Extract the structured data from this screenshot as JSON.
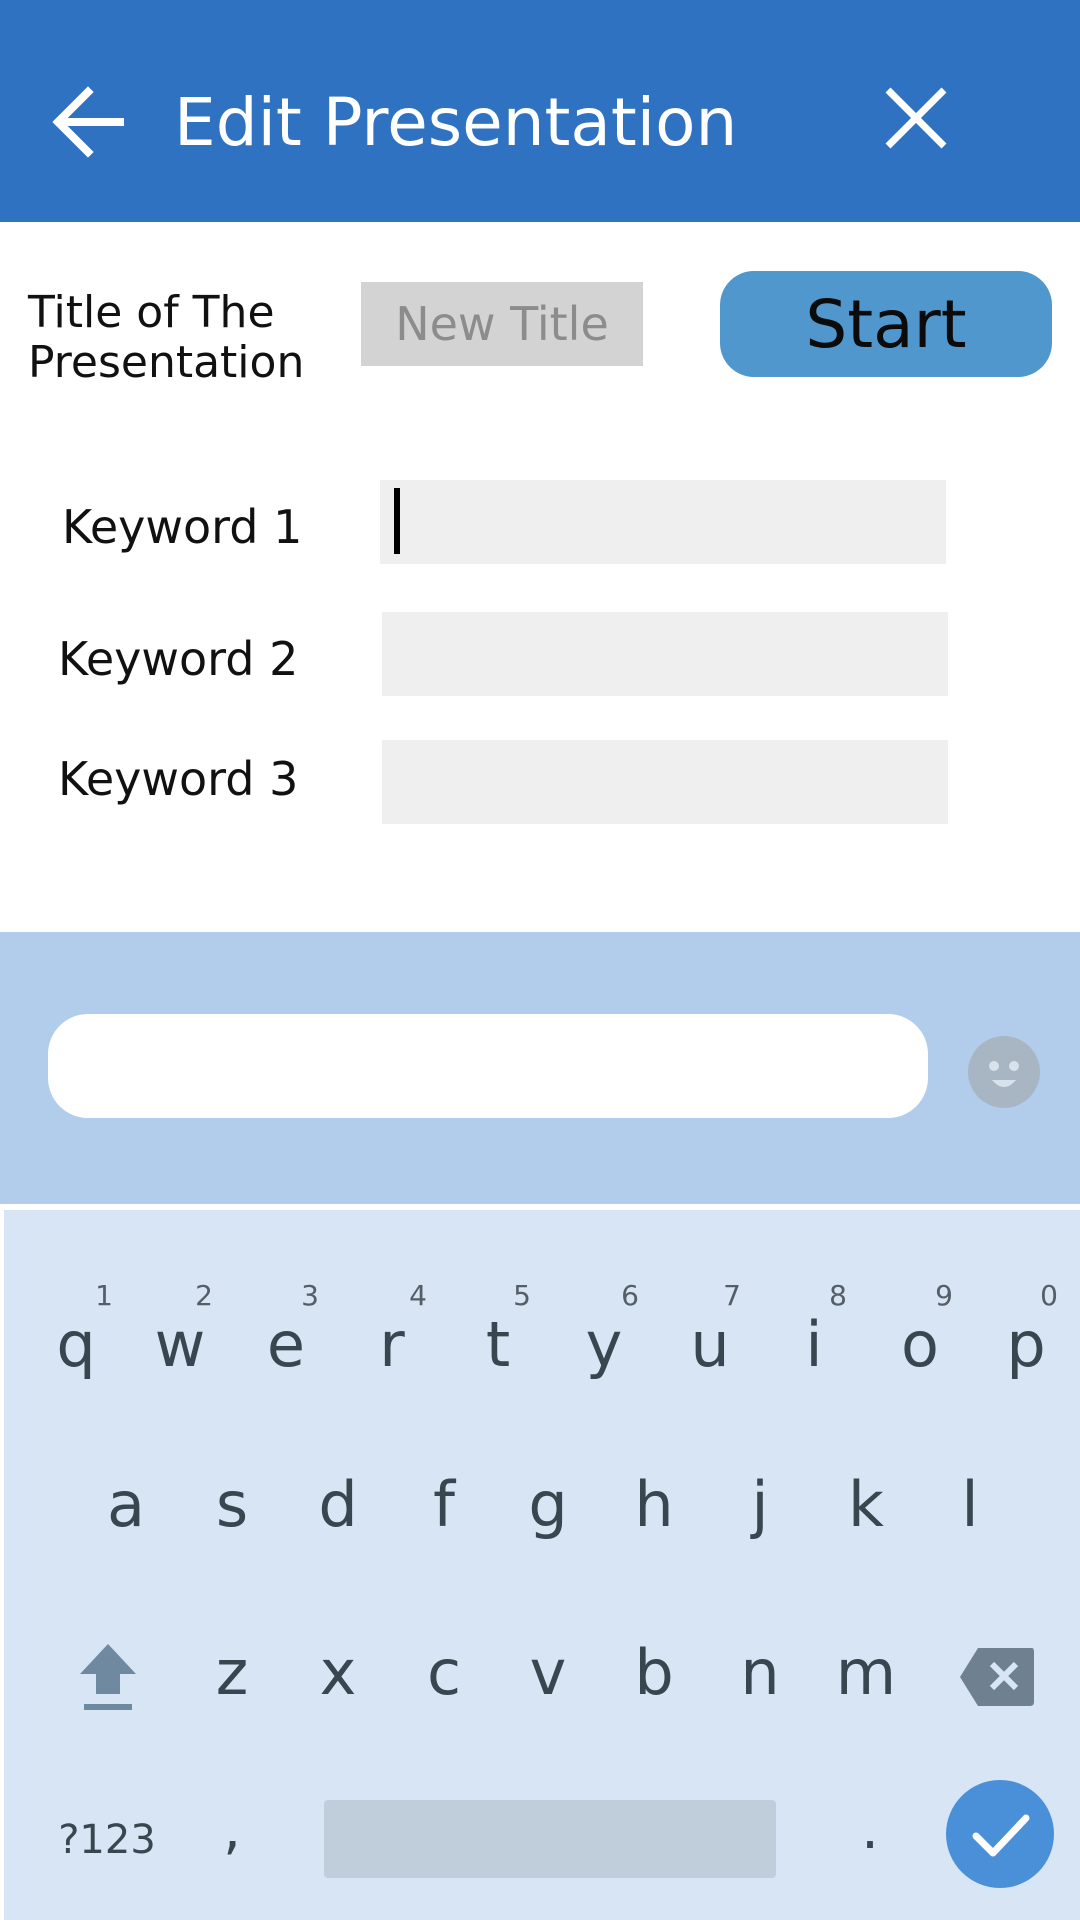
{
  "header": {
    "title": "Edit Presentation",
    "background_color": "#2f72c2",
    "back_icon": "arrow-left",
    "close_icon": "close-x"
  },
  "form": {
    "title_label": "Title of The Presentation",
    "title_placeholder": "New Title",
    "start_label": "Start",
    "start_color": "#4f97cc",
    "keywords": [
      {
        "label": "Keyword 1",
        "value": ""
      },
      {
        "label": "Keyword 2",
        "value": ""
      },
      {
        "label": "Keyword 3",
        "value": ""
      }
    ]
  },
  "keyboard": {
    "background_color": "#d8e5f5",
    "suggestion_bar_color": "#b2cdeb",
    "row1": [
      "q",
      "w",
      "e",
      "r",
      "t",
      "y",
      "u",
      "i",
      "o",
      "p"
    ],
    "row1_hints": [
      "1",
      "2",
      "3",
      "4",
      "5",
      "6",
      "7",
      "8",
      "9",
      "0"
    ],
    "row2": [
      "a",
      "s",
      "d",
      "f",
      "g",
      "h",
      "j",
      "k",
      "l"
    ],
    "row3": [
      "z",
      "x",
      "c",
      "v",
      "b",
      "n",
      "m"
    ],
    "num_label": "?123",
    "comma": ",",
    "period": ".",
    "shift_icon": "shift-arrow",
    "backspace_icon": "backspace",
    "enter_icon": "checkmark",
    "emoji_icon": "emoji-face",
    "accent_color": "#4a90d9"
  }
}
